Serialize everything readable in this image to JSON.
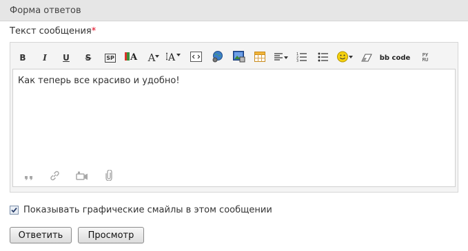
{
  "header": {
    "title": "Форма ответов"
  },
  "message_field": {
    "label": "Текст сообщения",
    "required_mark": "*"
  },
  "toolbar": {
    "bold": "B",
    "italic": "I",
    "underline": "U",
    "strike": "S",
    "spoiler": "SP",
    "font_size": "A",
    "bbcode": "bb code",
    "translit": "РУ RU"
  },
  "editor": {
    "value": "Как теперь все красиво и удобно!"
  },
  "smiles_option": {
    "label": "Показывать графические смайлы в этом сообщении",
    "checked": true
  },
  "buttons": {
    "reply": "Ответить",
    "preview": "Просмотр"
  },
  "colors": {
    "required": "#e0001a",
    "header_bg": "#e6e6e6",
    "editor_frame": "#f4f4f4"
  }
}
